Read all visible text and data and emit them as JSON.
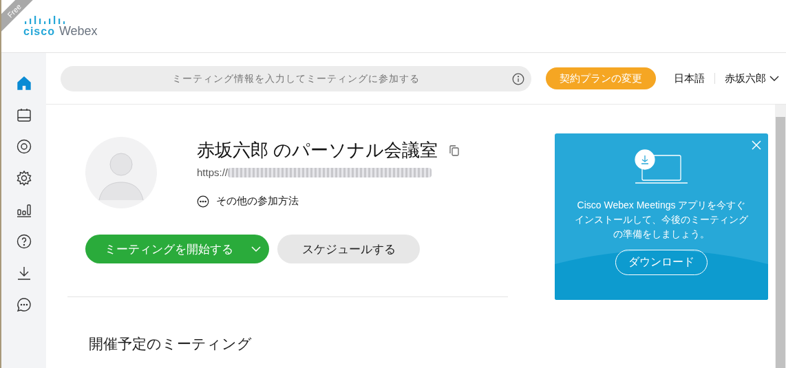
{
  "corner_badge": "Free",
  "logo": {
    "brand": "cisco",
    "product": "Webex"
  },
  "sidebar": {
    "items": [
      {
        "kind": "home",
        "selected": true
      },
      {
        "kind": "calendar",
        "selected": false
      },
      {
        "kind": "record",
        "selected": false
      },
      {
        "kind": "settings",
        "selected": false
      },
      {
        "kind": "chart",
        "selected": false
      },
      {
        "kind": "help",
        "selected": false
      },
      {
        "kind": "download",
        "selected": false
      },
      {
        "kind": "chat",
        "selected": false
      }
    ]
  },
  "topbar": {
    "join_field": {
      "placeholder": "ミーティング情報を入力してミーティングに参加する"
    },
    "upgrade_button": "契約プランの変更",
    "language": "日本語",
    "user": "赤坂六郎"
  },
  "room": {
    "title": "赤坂六郎 のパーソナル会議室",
    "url": "https://",
    "more_ways": "その他の参加方法",
    "start_button": "ミーティングを開始する",
    "schedule_button": "スケジュールする"
  },
  "upcoming_heading": "開催予定のミーティング",
  "promo": {
    "text": "Cisco Webex Meetings アプリを今すぐインストールして、今後のミーティングの準備をしましょう。",
    "button": "ダウンロード"
  }
}
